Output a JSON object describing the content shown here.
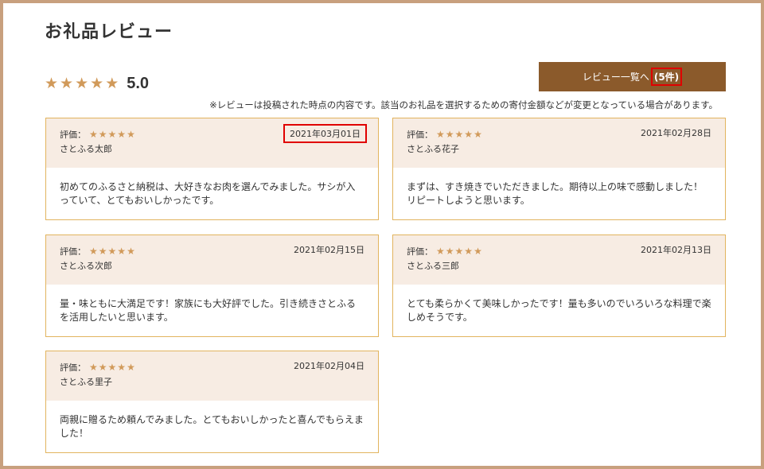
{
  "page": {
    "title": "お礼品レビュー",
    "average_score": "5.0",
    "average_stars": 5,
    "review_list_button": {
      "label": "レビュー一覧へ",
      "count": "(5件)"
    },
    "note": "※レビューは投稿された時点の内容です。該当のお礼品を選択するための寄付金額などが変更となっている場合があります。"
  },
  "colors": {
    "star": "#d19a5a",
    "button_bg": "#8b5a2b",
    "card_border": "#e2b45e",
    "card_head_bg": "#f7ece3",
    "highlight": "#e00000",
    "frame": "#c8a07e"
  },
  "reviews": [
    {
      "rating_label": "評価：",
      "stars": 5,
      "reviewer": "さとふる太郎",
      "date": "2021年03月01日",
      "text": "初めてのふるさと納税は、大好きなお肉を選んでみました。サシが入っていて、とてもおいしかったです。"
    },
    {
      "rating_label": "評価：",
      "stars": 5,
      "reviewer": "さとふる花子",
      "date": "2021年02月28日",
      "text": "まずは、すき焼きでいただきました。期待以上の味で感動しました！リピートしようと思います。"
    },
    {
      "rating_label": "評価：",
      "stars": 5,
      "reviewer": "さとふる次郎",
      "date": "2021年02月15日",
      "text": "量・味ともに大満足です！家族にも大好評でした。引き続きさとふるを活用したいと思います。"
    },
    {
      "rating_label": "評価：",
      "stars": 5,
      "reviewer": "さとふる三郎",
      "date": "2021年02月13日",
      "text": "とても柔らかくて美味しかったです！量も多いのでいろいろな料理で楽しめそうです。"
    },
    {
      "rating_label": "評価：",
      "stars": 5,
      "reviewer": "さとふる里子",
      "date": "2021年02月04日",
      "text": "両親に贈るため頼んでみました。とてもおいしかったと喜んでもらえました！"
    }
  ]
}
